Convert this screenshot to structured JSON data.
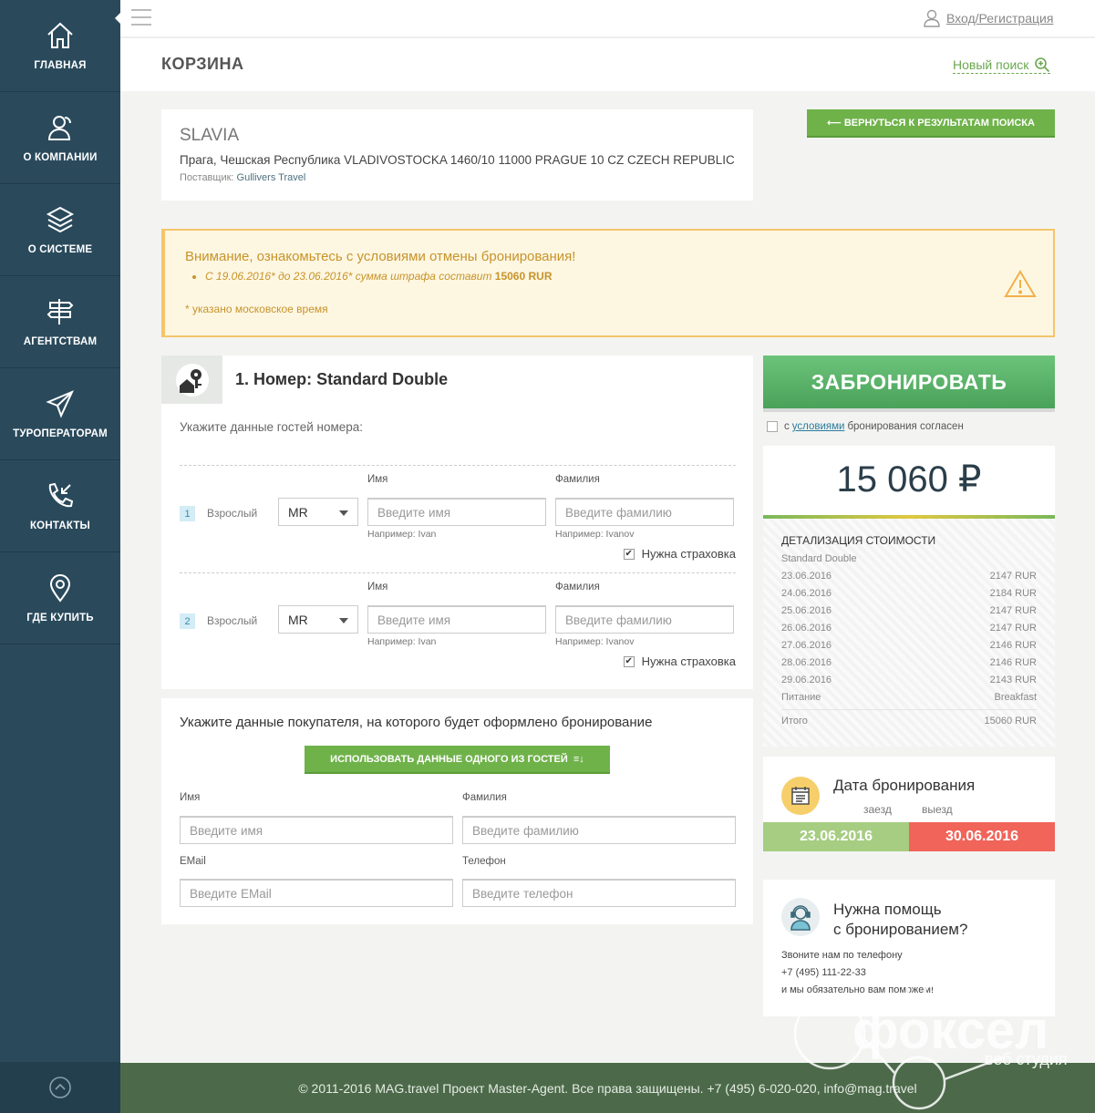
{
  "sidebar": {
    "items": [
      {
        "label": "ГЛАВНАЯ",
        "icon": "home-icon"
      },
      {
        "label": "О КОМПАНИИ",
        "icon": "users-icon"
      },
      {
        "label": "О СИСТЕМЕ",
        "icon": "layers-icon"
      },
      {
        "label": "АГЕНТСТВАМ",
        "icon": "signpost-icon"
      },
      {
        "label": "ТУРОПЕРАТОРАМ",
        "icon": "paper-plane-icon"
      },
      {
        "label": "КОНТАКТЫ",
        "icon": "phone-icon"
      },
      {
        "label": "ГДЕ КУПИТЬ",
        "icon": "map-pin-icon"
      }
    ]
  },
  "header": {
    "login_label": "Вход/Регистрация",
    "page_title": "КОРЗИНА",
    "new_search_label": "Новый поиск"
  },
  "hotel": {
    "name": "SLAVIA",
    "address": "Прага, Чешская Республика  VLADIVOSTOCKA 1460/10 11000 PRAGUE 10 CZ CZECH REPUBLIC",
    "supplier_label": "Поставщик:",
    "supplier": "Gullivers Travel"
  },
  "back_button_label": "⟵  ВЕРНУТЬСЯ К РЕЗУЛЬТАТАМ ПОИСКА",
  "warning": {
    "title": "Внимание, ознакомьтесь с условиями отмены бронирования!",
    "item_text": "С 19.06.2016* до 23.06.2016* сумма штрафа составит",
    "item_amount": "15060 RUR",
    "note": "* указано московское время"
  },
  "room": {
    "title": "1. Номер: Standard Double",
    "subtitle": "Укажите данные гостей номера:",
    "first_name_label": "Имя",
    "last_name_label": "Фамилия",
    "first_name_placeholder": "Введите имя",
    "last_name_placeholder": "Введите фамилию",
    "first_name_hint": "Например: Ivan",
    "last_name_hint": "Например: Ivanov",
    "insurance_label": "Нужна страховка",
    "guests": [
      {
        "number": "1",
        "type": "Взрослый",
        "title": "MR"
      },
      {
        "number": "2",
        "type": "Взрослый",
        "title": "MR"
      }
    ]
  },
  "buyer": {
    "title": "Укажите данные покупателя, на которого будет оформлено бронирование",
    "use_guest_button": "ИСПОЛЬЗОВАТЬ ДАННЫЕ ОДНОГО ИЗ ГОСТЕЙ",
    "first_name_label": "Имя",
    "last_name_label": "Фамилия",
    "email_label": "EMail",
    "phone_label": "Телефон",
    "first_name_placeholder": "Введите имя",
    "last_name_placeholder": "Введите фамилию",
    "email_placeholder": "Введите EMail",
    "phone_placeholder": "Введите телефон"
  },
  "booking": {
    "book_button": "ЗАБРОНИРОВАТЬ",
    "agree_prefix": "с",
    "agree_link": "условиями",
    "agree_suffix": "бронирования согласен"
  },
  "price": {
    "total_display": "15 060 ₽",
    "detail_title": "ДЕТАЛИЗАЦИЯ СТОИМОСТИ",
    "room_type": "Standard Double",
    "rows": [
      {
        "date": "23.06.2016",
        "amount": "2147 RUR"
      },
      {
        "date": "24.06.2016",
        "amount": "2184 RUR"
      },
      {
        "date": "25.06.2016",
        "amount": "2147 RUR"
      },
      {
        "date": "26.06.2016",
        "amount": "2147 RUR"
      },
      {
        "date": "27.06.2016",
        "amount": "2146 RUR"
      },
      {
        "date": "28.06.2016",
        "amount": "2146 RUR"
      },
      {
        "date": "29.06.2016",
        "amount": "2143 RUR"
      }
    ],
    "meal_label": "Питание",
    "meal_value": "Breakfast",
    "total_label": "Итого",
    "total_value": "15060 RUR"
  },
  "dates": {
    "title": "Дата бронирования",
    "checkin_label": "заезд",
    "checkout_label": "выезд",
    "checkin": "23.06.2016",
    "checkout": "30.06.2016"
  },
  "help": {
    "title_line1": "Нужна помощь",
    "title_line2": "с бронированием?",
    "line1": "Звоните нам по телефону",
    "phone": "+7 (495) 111-22-33",
    "line3": "и мы обязательно вам поможем!"
  },
  "footer": {
    "text": "© 2011-2016 MAG.travel Проект Master-Agent. Все права защищены. +7 (495) 6-020-020, info@mag.travel"
  },
  "watermark": {
    "text": "фоксел",
    "subtext": "веб студия"
  },
  "colors": {
    "sidebar": "#2a4a5c",
    "accent_green": "#6fb24a",
    "warning_border": "#f5c56a",
    "checkin": "#a6cd81",
    "checkout": "#f0645a",
    "footer": "#4c6a4a"
  }
}
